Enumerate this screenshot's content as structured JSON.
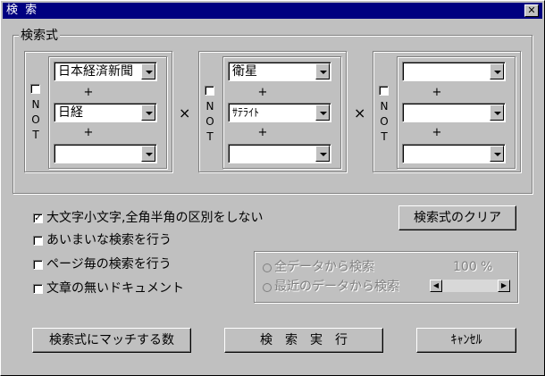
{
  "window": {
    "title": "検 索",
    "close_glyph": "✕"
  },
  "search_group": {
    "legend": "検索式",
    "times_glyph": "×",
    "plus_glyph": "+",
    "columns": [
      {
        "not_label": [
          "N",
          "O",
          "T"
        ],
        "not_checked": false,
        "terms": [
          "日本経済新聞",
          "日経",
          ""
        ]
      },
      {
        "not_label": [
          "N",
          "O",
          "T"
        ],
        "not_checked": false,
        "terms": [
          "衛星",
          "ｻﾃﾗｲﾄ",
          ""
        ]
      },
      {
        "not_label": [
          "N",
          "O",
          "T"
        ],
        "not_checked": false,
        "terms": [
          "",
          "",
          ""
        ]
      }
    ]
  },
  "options": [
    {
      "label": "大文字小文字,全角半角の区別をしない",
      "checked": true
    },
    {
      "label": "あいまいな検索を行う",
      "checked": false
    },
    {
      "label": "ページ毎の検索を行う",
      "checked": false
    },
    {
      "label": "文章の無いドキュメント",
      "checked": false
    }
  ],
  "clear_button": "検索式のクリア",
  "scope": {
    "all_data": "全データから検索",
    "recent_data": "最近のデータから検索",
    "percent": "100 %"
  },
  "buttons": {
    "match_count": "検索式にマッチする数",
    "execute": "検　索　実　行",
    "cancel": "ｷｬﾝｾﾙ"
  }
}
